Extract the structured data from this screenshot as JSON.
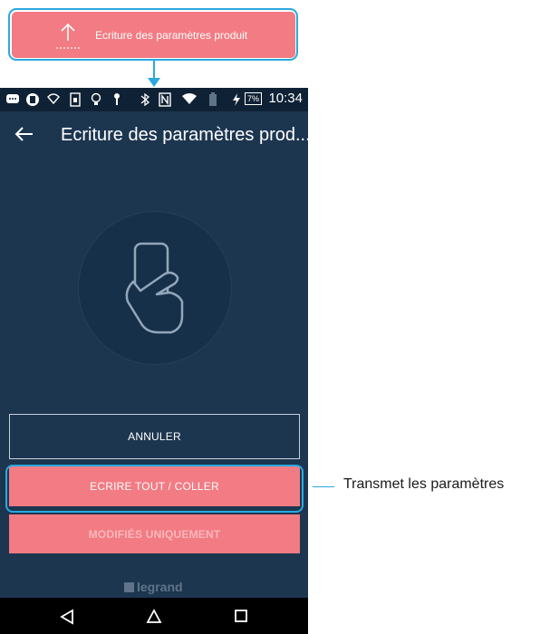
{
  "callout": {
    "label": "Ecriture des paramètres produit",
    "icon": "upload-arrow-icon"
  },
  "status_bar": {
    "time": "10:34",
    "battery": "7%",
    "icons": [
      "messages-icon",
      "signal-circle-icon",
      "wifi-outline-icon",
      "sim-icon",
      "bulb-icon",
      "key-icon",
      "bluetooth-icon",
      "nfc-icon",
      "wifi-icon",
      "battery-saver-icon",
      "charging-icon"
    ]
  },
  "app_bar": {
    "title": "Ecriture des paramètres prod...",
    "back_icon": "back-arrow-icon"
  },
  "illustration": {
    "icon": "phone-in-hand-icon"
  },
  "buttons": {
    "cancel": "ANNULER",
    "write_all": "ECRIRE TOUT / COLLER",
    "modified_only": "MODIFIÉS UNIQUEMENT"
  },
  "brand": "legrand",
  "nav_bar": {
    "icons": [
      "back-triangle-icon",
      "home-circle-icon",
      "recents-square-icon"
    ]
  },
  "annotation": "Transmet les paramètres",
  "colors": {
    "accent": "#f37b83",
    "background": "#1d3650",
    "highlight": "#2aa9df"
  }
}
